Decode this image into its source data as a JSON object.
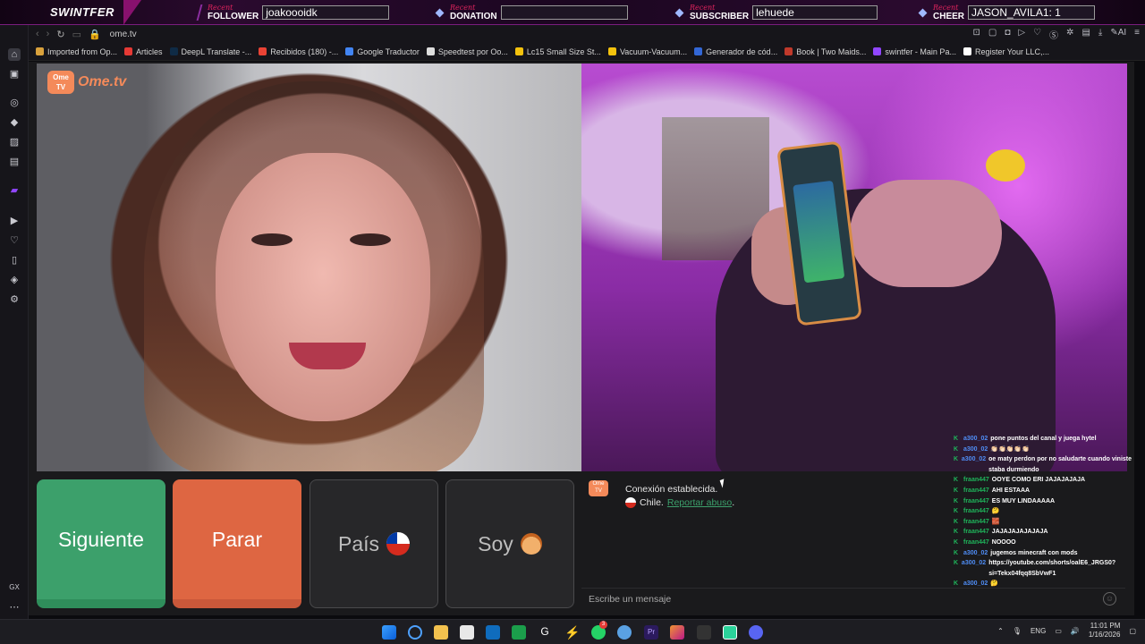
{
  "overlay": {
    "brand": "SWINTFER",
    "recent_label": "Recent",
    "follower": {
      "kind": "FOLLOWER",
      "value": "joakoooidk"
    },
    "donation": {
      "kind": "DONATION",
      "value": ""
    },
    "subscriber": {
      "kind": "SUBSCRIBER",
      "value": "lehuede"
    },
    "cheer": {
      "kind": "CHEER",
      "value": "JASON_AVILA1: 1"
    }
  },
  "browser": {
    "url": "ome.tv",
    "ai_label": "AI",
    "bookmarks": [
      {
        "label": "Imported from Op...",
        "color": "#d9a13c"
      },
      {
        "label": "Articles",
        "color": "#e53935"
      },
      {
        "label": "DeepL Translate -...",
        "color": "#0f2b46"
      },
      {
        "label": "Recibidos (180) -...",
        "color": "#ea4335"
      },
      {
        "label": "Google Traductor",
        "color": "#4285f4"
      },
      {
        "label": "Speedtest por Oo...",
        "color": "#dddddd"
      },
      {
        "label": "Lc15 Small Size St...",
        "color": "#f4c20d"
      },
      {
        "label": "Vacuum-Vacuum...",
        "color": "#f4c20d"
      },
      {
        "label": "Generador de cód...",
        "color": "#3367d6"
      },
      {
        "label": "Book | Two Maids...",
        "color": "#c0392b"
      },
      {
        "label": "swintfer - Main Pa...",
        "color": "#9146ff"
      },
      {
        "label": "Register Your LLC,...",
        "color": "#ffffff"
      }
    ],
    "rail_bottom": "GX"
  },
  "omegle": {
    "logo_badge": "Ome TV",
    "logo_text": "Ome.tv",
    "buttons": {
      "next": "Siguiente",
      "stop": "Parar",
      "country": "País",
      "me": "Soy"
    },
    "status": "Conexión establecida.",
    "country": "Chile.",
    "report": "Reportar abuso",
    "report_suffix": ".",
    "input_placeholder": "Escribe un mensaje"
  },
  "twitch_chat": [
    {
      "user": "a300_02",
      "color": "#4f8df5",
      "msg": "pone puntos del canal y juega hytel"
    },
    {
      "user": "a300_02",
      "color": "#4f8df5",
      "msg": "👏🏻👏🏻👏🏻👏🏻👏🏻"
    },
    {
      "user": "a300_02",
      "color": "#4f8df5",
      "msg": "oe maty perdon por no saludarte cuando viniste staba durmiendo"
    },
    {
      "user": "fraan447",
      "color": "#1fb35a",
      "msg": "OOYE COMO ERI JAJAJAJAJA"
    },
    {
      "user": "fraan447",
      "color": "#1fb35a",
      "msg": "AHI ESTAAA"
    },
    {
      "user": "fraan447",
      "color": "#1fb35a",
      "msg": "ES MUY LINDAAAAA"
    },
    {
      "user": "fraan447",
      "color": "#1fb35a",
      "msg": "🤔"
    },
    {
      "user": "fraan447",
      "color": "#1fb35a",
      "msg": "🧱"
    },
    {
      "user": "fraan447",
      "color": "#1fb35a",
      "msg": "JAJAJAJAJAJAJA"
    },
    {
      "user": "fraan447",
      "color": "#1fb35a",
      "msg": "NOOOO"
    },
    {
      "user": "a300_02",
      "color": "#4f8df5",
      "msg": "jugemos minecraft con mods"
    },
    {
      "user": "a300_02",
      "color": "#4f8df5",
      "msg": "https://youtube.com/shorts/oalE6_JRGS0?si=Tekx04fqq8SbVwF1"
    },
    {
      "user": "a300_02",
      "color": "#4f8df5",
      "msg": "🤔"
    }
  ],
  "taskbar": {
    "lang": "ENG",
    "time": "11:01 PM",
    "date": "1/16/2026",
    "whatsapp_badge": "3"
  },
  "colors": {
    "accent_green": "#3ca06b",
    "accent_orange": "#de6642",
    "overlay_purple": "#7a1d7e"
  }
}
